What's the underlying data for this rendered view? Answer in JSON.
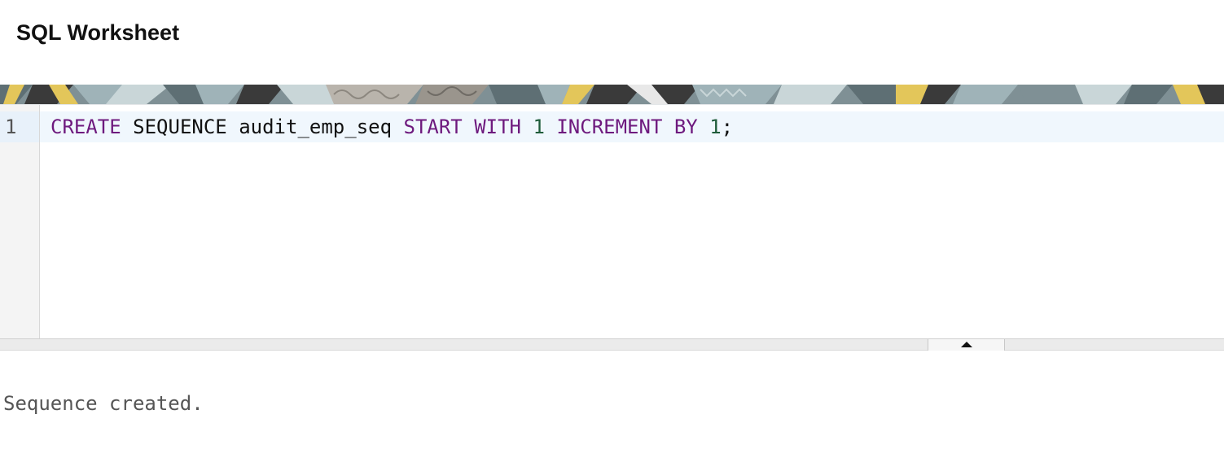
{
  "header": {
    "title": "SQL Worksheet"
  },
  "banner": {
    "decorative": true,
    "colors": [
      "#5e6f74",
      "#9fb3b8",
      "#c9d6d8",
      "#e3c65a",
      "#3a3a3a",
      "#b9b4ac",
      "#7f9095"
    ]
  },
  "editor": {
    "line_numbers": [
      "1"
    ],
    "lines": [
      {
        "tokens": [
          {
            "text": "CREATE",
            "type": "keyword"
          },
          {
            "text": " ",
            "type": "space"
          },
          {
            "text": "SEQUENCE",
            "type": "identifier"
          },
          {
            "text": " ",
            "type": "space"
          },
          {
            "text": "audit_emp_seq",
            "type": "identifier"
          },
          {
            "text": " ",
            "type": "space"
          },
          {
            "text": "START",
            "type": "keyword"
          },
          {
            "text": " ",
            "type": "space"
          },
          {
            "text": "WITH",
            "type": "keyword"
          },
          {
            "text": " ",
            "type": "space"
          },
          {
            "text": "1",
            "type": "number"
          },
          {
            "text": " ",
            "type": "space"
          },
          {
            "text": "INCREMENT",
            "type": "keyword"
          },
          {
            "text": " ",
            "type": "space"
          },
          {
            "text": "BY",
            "type": "keyword"
          },
          {
            "text": " ",
            "type": "space"
          },
          {
            "text": "1",
            "type": "number"
          },
          {
            "text": ";",
            "type": "punctuation"
          }
        ]
      }
    ],
    "colors": {
      "keyword": "#6e1a7e",
      "number": "#1f5c3a",
      "identifier": "#111111",
      "active_line": "#f0f7fd"
    }
  },
  "splitter": {
    "toggle_icon": "triangle-up-icon"
  },
  "output": {
    "message": "Sequence created."
  }
}
